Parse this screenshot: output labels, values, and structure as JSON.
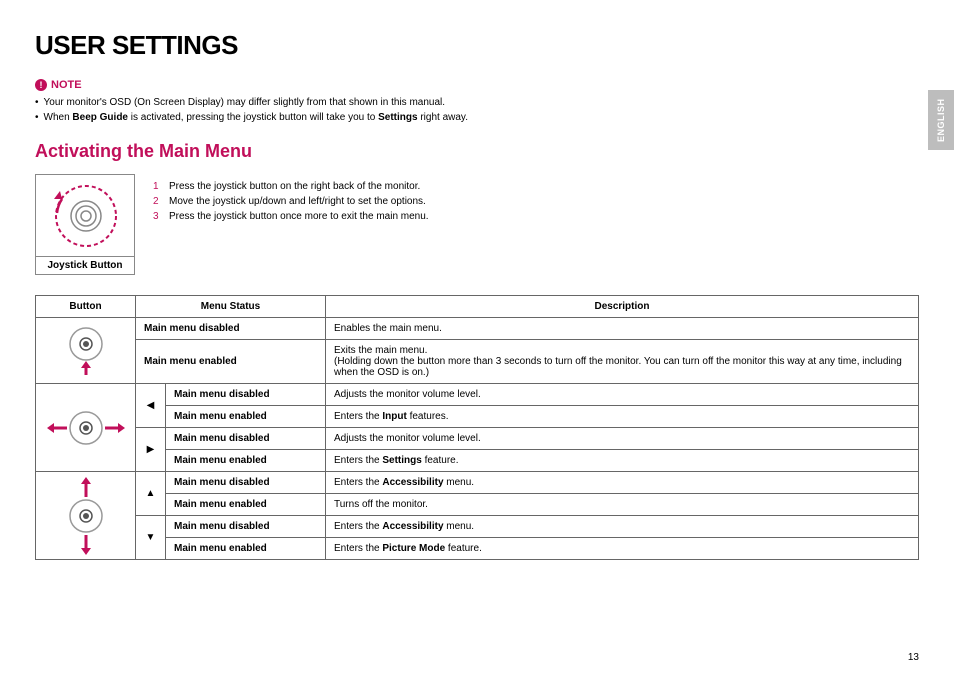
{
  "lang_tab": "ENGLISH",
  "page_title": "USER SETTINGS",
  "note": {
    "heading": "NOTE",
    "items": [
      "Your monitor's OSD (On Screen Display) may differ slightly from that shown in this manual.",
      "When Beep Guide is activated, pressing the joystick button will take you to Settings right away."
    ],
    "item2_bold1": "Beep Guide",
    "item2_bold2": "Settings"
  },
  "activating": {
    "heading": "Activating the Main Menu",
    "caption": "Joystick Button",
    "steps": {
      "s1": "Press the joystick button on the right back of the monitor.",
      "s2": "Move the joystick up/down and left/right to set the options.",
      "s3": "Press the joystick button once more to exit the main menu."
    }
  },
  "table": {
    "h1": "Button",
    "h2": "Menu Status",
    "h3": "Description",
    "press": {
      "status_dis": "Main menu disabled",
      "desc_dis": "Enables the main menu.",
      "status_en": "Main menu enabled",
      "desc_en_line1": "Exits the main menu.",
      "desc_en_line2": "(Holding down the button more than 3 seconds to turn off the monitor. You can turn off the monitor this way at any time, including when the OSD is on.)"
    },
    "left": {
      "dis": "Main menu disabled",
      "dis_desc": "Adjusts the monitor volume level.",
      "en": "Main menu enabled",
      "en_desc_pre": "Enters the ",
      "en_desc_bold": "Input",
      "en_desc_post": " features."
    },
    "right": {
      "dis": "Main menu disabled",
      "dis_desc": "Adjusts the monitor volume level.",
      "en": "Main menu enabled",
      "en_desc_pre": "Enters the ",
      "en_desc_bold": "Settings",
      "en_desc_post": " feature."
    },
    "up": {
      "dis": "Main menu disabled",
      "dis_desc_pre": "Enters the ",
      "dis_desc_bold": "Accessibility",
      "dis_desc_post": " menu.",
      "en": "Main menu enabled",
      "en_desc": "Turns off the monitor."
    },
    "down": {
      "dis": "Main menu disabled",
      "dis_desc_pre": "Enters the ",
      "dis_desc_bold": "Accessibility",
      "dis_desc_post": " menu.",
      "en": "Main menu enabled",
      "en_desc_pre": "Enters the ",
      "en_desc_bold": "Picture Mode",
      "en_desc_post": " feature."
    }
  },
  "page_no": "13"
}
